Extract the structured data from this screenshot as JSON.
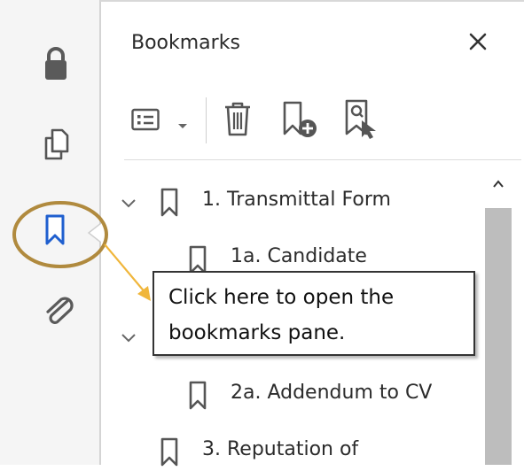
{
  "left_rail": {
    "icons": [
      "lock-icon",
      "copy-pages-icon",
      "bookmark-icon",
      "attachment-icon"
    ],
    "active": "bookmark-icon",
    "highlight_color": "#b08a3e"
  },
  "pane": {
    "title": "Bookmarks",
    "close_icon": "close-icon",
    "toolbar": [
      "options-icon",
      "chevron-down-icon",
      "delete-icon",
      "new-bookmark-icon",
      "find-bookmark-icon"
    ]
  },
  "bookmarks": [
    {
      "label": "1. Transmittal Form",
      "expanded": true
    },
    {
      "label": "1a. Candidate"
    },
    {
      "label": "2a. Addendum to CV"
    },
    {
      "label": "3. Reputation of"
    }
  ],
  "callout": {
    "text": "Click here to open the bookmarks pane."
  },
  "colors": {
    "active_icon": "#1f5fcf",
    "arrow": "#f0b63b",
    "ring": "#b08a3e"
  }
}
